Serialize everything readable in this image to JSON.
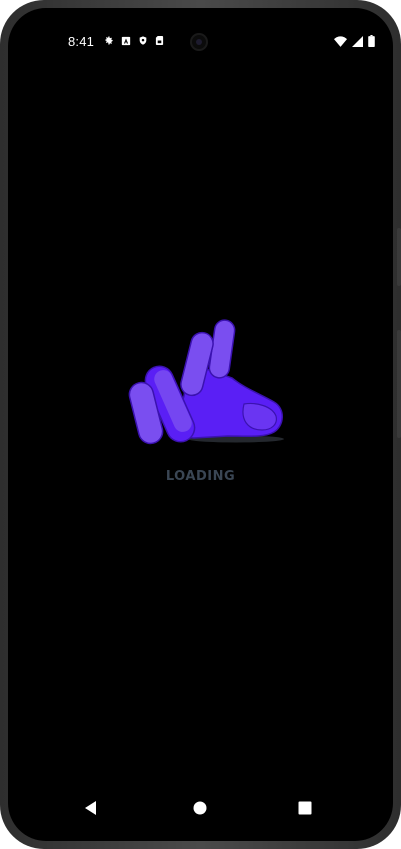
{
  "status_bar": {
    "time": "8:41",
    "icons_left": [
      "settings-icon",
      "a-box-icon",
      "shield-icon",
      "sim-card-icon"
    ],
    "icons_right": [
      "wifi-icon",
      "signal-icon",
      "battery-icon"
    ]
  },
  "loader": {
    "label": "LOADING",
    "graphic": "pointing-hand-icon",
    "colors": {
      "hand_primary": "#5a1ff5",
      "hand_fingers": "#7a4ef0",
      "text": "#3a4654",
      "background": "#000000"
    }
  },
  "nav_bar": {
    "buttons": [
      "back-icon",
      "home-icon",
      "recents-icon"
    ]
  }
}
